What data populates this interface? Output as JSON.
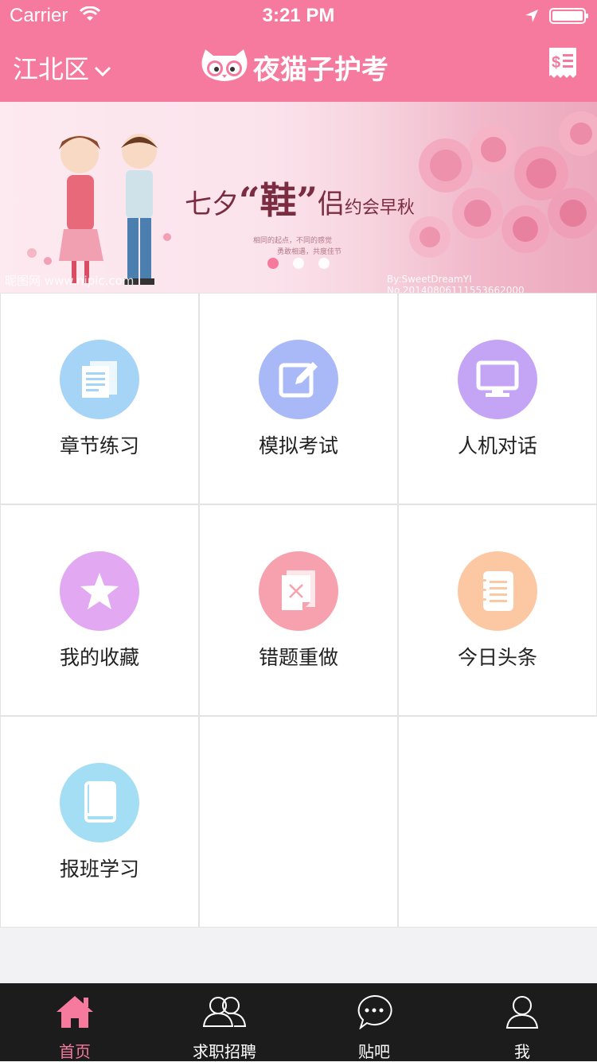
{
  "status_bar": {
    "carrier": "Carrier",
    "time": "3:21 PM"
  },
  "nav": {
    "city": "江北区",
    "title": "夜猫子护考",
    "bill_icon": "bill-icon"
  },
  "banner": {
    "headline_a": "七夕",
    "headline_b": "“鞋”",
    "headline_c": "侣",
    "headline_d": "约会早秋",
    "caption_line1": "相同的起点，不同的感觉",
    "caption_line2": "勇敢相遇，共度佳节",
    "watermark_left": "昵图网 www.nipic.com",
    "watermark_right": "By:SweetDreamYI No.20140806111553662000",
    "slide_count": 3,
    "active_slide": 1
  },
  "menu": [
    {
      "label": "章节练习",
      "icon": "document-icon",
      "color": "#a6d4f7"
    },
    {
      "label": "模拟考试",
      "icon": "edit-icon",
      "color": "#a9b8f7"
    },
    {
      "label": "人机对话",
      "icon": "monitor-icon",
      "color": "#c4a4f5"
    },
    {
      "label": "我的收藏",
      "icon": "star-icon",
      "color": "#e2a8f2"
    },
    {
      "label": "错题重做",
      "icon": "wrong-page-icon",
      "color": "#f7a1ae"
    },
    {
      "label": "今日头条",
      "icon": "notebook-icon",
      "color": "#fcc8a3"
    },
    {
      "label": "报班学习",
      "icon": "book-icon",
      "color": "#a3def4"
    }
  ],
  "tabs": [
    {
      "label": "首页",
      "icon": "home-icon",
      "active": true
    },
    {
      "label": "求职招聘",
      "icon": "people-icon",
      "active": false
    },
    {
      "label": "贴吧",
      "icon": "chat-bubble-icon",
      "active": false
    },
    {
      "label": "我",
      "icon": "person-icon",
      "active": false
    }
  ],
  "colors": {
    "accent": "#f57a9e",
    "tabbar_bg": "#1c1c1c"
  }
}
